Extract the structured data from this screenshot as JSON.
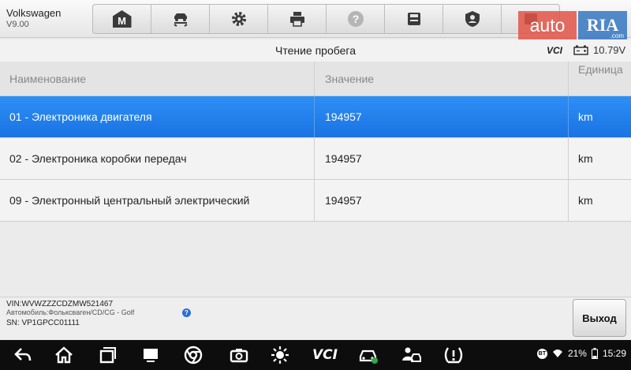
{
  "vehicle": {
    "make": "Volkswagen",
    "version": "V9.00"
  },
  "toolbar": {
    "items": [
      "home-icon",
      "vehicle-swap-icon",
      "settings-icon",
      "print-icon",
      "help-icon",
      "save-icon",
      "profile-icon",
      "data-icon"
    ],
    "home_letter": "M"
  },
  "watermark": {
    "left": "auto",
    "right": "RIA",
    "suffix": ".com"
  },
  "titlebar": {
    "title": "Чтение пробега",
    "vci": "VCI",
    "voltage": "10.79V"
  },
  "table": {
    "headers": [
      "Наименование",
      "Значение",
      "Единица"
    ],
    "rows": [
      {
        "name": "01 - Электроника двигателя",
        "value": "194957",
        "unit": "km",
        "selected": true
      },
      {
        "name": "02 - Электроника коробки передач",
        "value": "194957",
        "unit": "km",
        "selected": false
      },
      {
        "name": "09 - Электронный центральный электрический",
        "value": "194957",
        "unit": "km",
        "selected": false
      }
    ]
  },
  "footer": {
    "vin": "VIN:WVWZZZCDZMW521467",
    "car": "Автомобиль:Фольксваген/CD/CG - Golf",
    "sn": "SN: VP1GPCC01111",
    "exit_label": "Выход"
  },
  "status": {
    "battery": "21%",
    "time": "15:29",
    "vci_label": "VCI"
  },
  "colors": {
    "selected_row": "#1f7ae8",
    "watermark_auto": "#e25346",
    "watermark_ria": "#286ebe"
  }
}
